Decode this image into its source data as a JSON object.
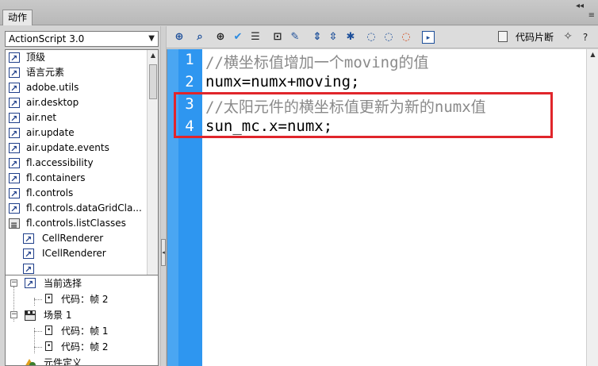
{
  "panel": {
    "tab_label": "动作",
    "collapse_glyph": "◂◂",
    "menu_glyph": "≡"
  },
  "library": {
    "dropdown_value": "ActionScript 3.0",
    "items": [
      {
        "label": "顶级",
        "icon": "class-arrow-icon"
      },
      {
        "label": "语言元素",
        "icon": "class-arrow-icon"
      },
      {
        "label": "adobe.utils",
        "icon": "class-arrow-icon"
      },
      {
        "label": "air.desktop",
        "icon": "class-arrow-icon"
      },
      {
        "label": "air.net",
        "icon": "class-arrow-icon"
      },
      {
        "label": "air.update",
        "icon": "class-arrow-icon"
      },
      {
        "label": "air.update.events",
        "icon": "class-arrow-icon"
      },
      {
        "label": "fl.accessibility",
        "icon": "class-arrow-icon"
      },
      {
        "label": "fl.containers",
        "icon": "class-arrow-icon"
      },
      {
        "label": "fl.controls",
        "icon": "class-arrow-icon"
      },
      {
        "label": "fl.controls.dataGridCla...",
        "icon": "class-arrow-icon"
      },
      {
        "label": "fl.controls.listClasses",
        "icon": "book-open-icon"
      },
      {
        "label": "CellRenderer",
        "icon": "class-arrow-icon"
      },
      {
        "label": "ICellRenderer",
        "icon": "class-arrow-icon"
      }
    ]
  },
  "tree": {
    "current_selection": "当前选择",
    "code_frame_2": "代码：帧 2",
    "scene_1": "场景 1",
    "scene_code_frame_1": "代码：帧 1",
    "scene_code_frame_2": "代码：帧 2",
    "symbol_definition": "元件定义"
  },
  "toolbar": {
    "snippets_label": "代码片断",
    "help_glyph": "?",
    "icons": [
      "add-script-icon",
      "find-icon",
      "target-icon",
      "check-syntax-icon",
      "auto-format-icon",
      "show-hint-icon",
      "debug-options-icon",
      "collapse-between-braces-icon",
      "collapse-selection-icon",
      "expand-all-icon",
      "apply-block-comment-icon",
      "apply-line-comment-icon",
      "remove-comment-icon",
      "show-hide-toolbox-icon"
    ]
  },
  "code": {
    "lines": [
      {
        "num": "1",
        "text": "//横坐标值增加一个moving的值",
        "kind": "comment"
      },
      {
        "num": "2",
        "text": "numx=numx+moving;",
        "kind": "normal"
      },
      {
        "num": "3",
        "text": "//太阳元件的横坐标值更新为新的numx值",
        "kind": "comment"
      },
      {
        "num": "4",
        "text": "sun_mc.x=numx;",
        "kind": "normal"
      }
    ]
  },
  "colors": {
    "gutter": "#2e96f0",
    "highlight_border": "#e0252b",
    "comment": "#8a8a8a"
  }
}
